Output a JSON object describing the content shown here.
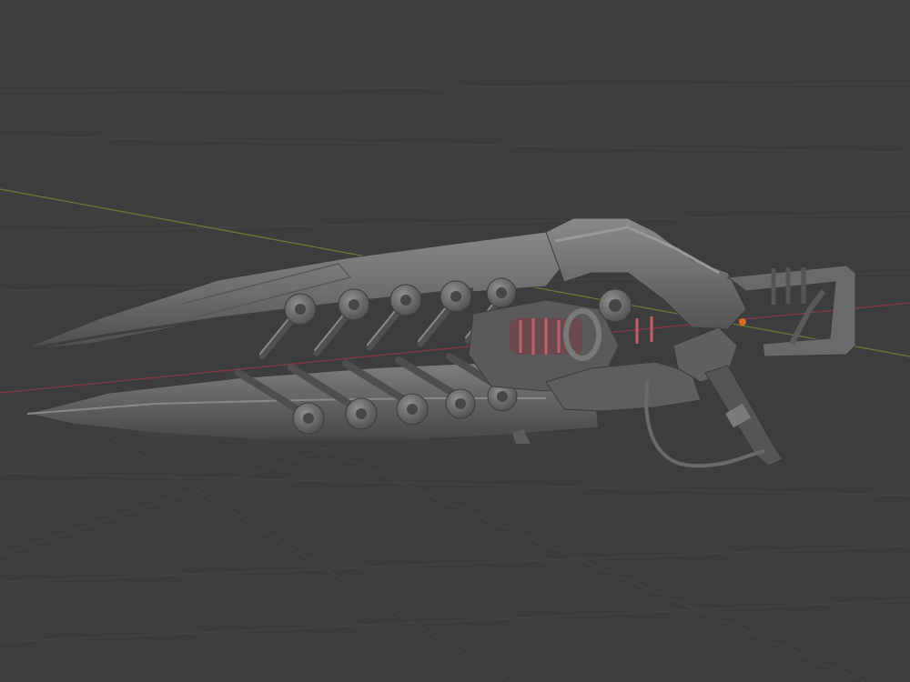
{
  "viewport": {
    "background": "#3d3d3d",
    "grid_color": "#474747",
    "x_axis_color": "#8a3a45",
    "y_axis_color": "#6b7d3a",
    "origin_color": "#e06a2a"
  },
  "model": {
    "base_color": "#6e6e6e",
    "shade_color": "#4a4a4a",
    "highlight_color": "#8c8c8c",
    "accent_color": "#c0606a",
    "upper_gear_count": 5,
    "lower_gear_count": 5
  }
}
